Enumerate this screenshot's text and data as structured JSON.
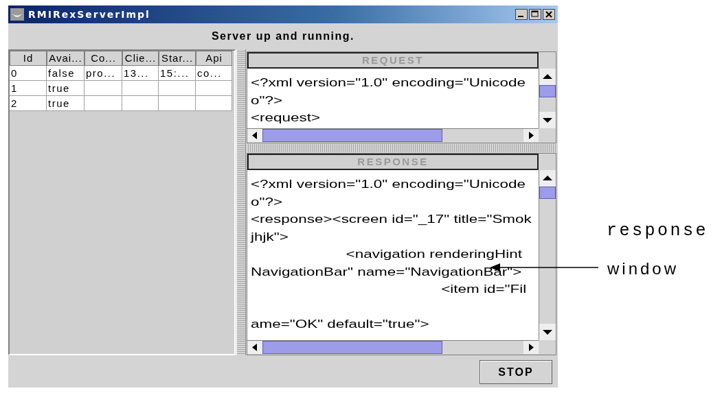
{
  "window": {
    "title": "RMIRexServerImpl"
  },
  "status": "Server up and running.",
  "table": {
    "columns": [
      "Id",
      "Avai...",
      "Co...",
      "Clie...",
      "Star...",
      "Api"
    ],
    "rows": [
      [
        "0",
        "false",
        "pro...",
        "13...",
        "15:...",
        "co..."
      ],
      [
        "1",
        "true"
      ],
      [
        "2",
        "true"
      ]
    ]
  },
  "request": {
    "title": "REQUEST",
    "lines": [
      {
        "text": "<?xml version=\"1.0\" encoding=\"Unicode"
      },
      {
        "text": "o\"?>"
      },
      {
        "text": "<request>"
      }
    ]
  },
  "response": {
    "title": "RESPONSE",
    "lines": [
      {
        "text": "<?xml version=\"1.0\" encoding=\"Unicode"
      },
      {
        "text": "o\"?>"
      },
      {
        "text": "<response><screen id=\"_17\" title=\"Smok"
      },
      {
        "text": "jhjk\">"
      },
      {
        "text": "\t\t\t<navigation renderingHint"
      },
      {
        "text": "NavigationBar\" name=\"NavigationBar\">"
      },
      {
        "text": "\t\t\t\t\t\t<item id=\"Fil"
      },
      {
        "text": "ame=\"OK\" default=\"true\">",
        "gap_before": true
      }
    ]
  },
  "buttons": [
    "STOP"
  ],
  "annotation": {
    "label_1": "response",
    "label_2": "window"
  }
}
